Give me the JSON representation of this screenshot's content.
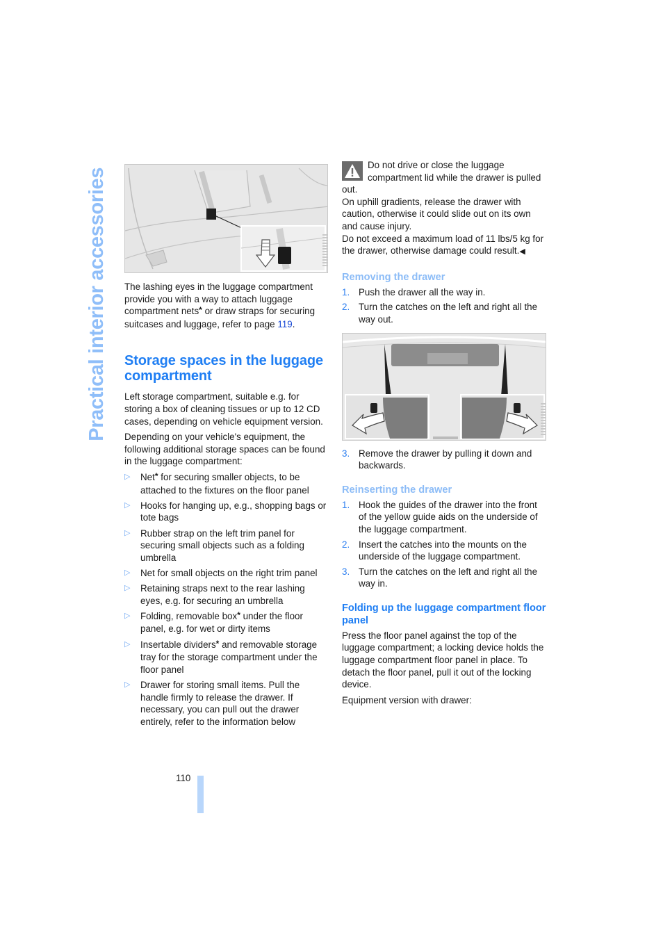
{
  "side_title": "Practical interior accessories",
  "left": {
    "figure1_alt": "Rear seat with lashing eye and belt strap, inset showing strap attachment with arrow",
    "intro": {
      "before_star": "The lashing eyes in the luggage compartment provide you with a way to attach luggage compartment nets",
      "star": "*",
      "after_star": " or draw straps for securing suitcases and luggage, refer to page ",
      "page_link": "119",
      "end": "."
    },
    "section_title": "Storage spaces in the luggage compartment",
    "para1": "Left storage compartment, suitable e.g. for storing a box of cleaning tissues or up to 12 CD cases, depending on vehicle equipment version.",
    "para2": "Depending on your vehicle's equipment, the following additional storage spaces can be found in the luggage compartment:",
    "bullet_glyph": "▷",
    "bullets": [
      {
        "pre": "Net",
        "star": "*",
        "post": " for securing smaller objects, to be attached to the fixtures on the floor panel"
      },
      {
        "pre": "Hooks for hanging up, e.g., shopping bags or tote bags",
        "star": "",
        "post": ""
      },
      {
        "pre": "Rubber strap on the left trim panel for securing small objects such as a folding umbrella",
        "star": "",
        "post": ""
      },
      {
        "pre": "Net for small objects on the right trim panel",
        "star": "",
        "post": ""
      },
      {
        "pre": "Retaining straps next to the rear lashing eyes, e.g. for securing an umbrella",
        "star": "",
        "post": ""
      },
      {
        "pre": "Folding, removable box",
        "star": "*",
        "post": " under the floor panel, e.g. for wet or dirty items"
      },
      {
        "pre": "Insertable dividers",
        "star": "*",
        "post": " and removable storage tray for the storage compartment under the floor panel"
      },
      {
        "pre": "Drawer for storing small items. Pull the handle firmly to release the drawer. If necessary, you can pull out the drawer entirely, refer to the information below",
        "star": "",
        "post": ""
      }
    ]
  },
  "right": {
    "warning": {
      "icon": "warning-triangle-icon",
      "lines": [
        "Do not drive or close the luggage compartment lid while the drawer is pulled out.",
        "On uphill gradients, release the drawer with caution, otherwise it could slide out on its own and cause injury.",
        "Do not exceed a maximum load of 11 lbs/5 kg for the drawer, otherwise damage could result."
      ],
      "end_mark": "◀"
    },
    "removing": {
      "title": "Removing the drawer",
      "steps_before_figure": [
        {
          "num": "1.",
          "text": "Push the drawer all the way in."
        },
        {
          "num": "2.",
          "text": "Turn the catches on the left and right all the way out."
        }
      ],
      "figure_alt": "Luggage compartment underside with two catches turned outward, arrows indicating direction",
      "steps_after_figure": [
        {
          "num": "3.",
          "text": "Remove the drawer by pulling it down and backwards."
        }
      ]
    },
    "reinserting": {
      "title": "Reinserting the drawer",
      "steps": [
        {
          "num": "1.",
          "text": "Hook the guides of the drawer into the front of the yellow guide aids on the underside of the luggage compartment."
        },
        {
          "num": "2.",
          "text": "Insert the catches into the mounts on the underside of the luggage compartment."
        },
        {
          "num": "3.",
          "text": "Turn the catches on the left and right all the way in."
        }
      ]
    },
    "folding": {
      "title": "Folding up the luggage compartment floor panel",
      "para": "Press the floor panel against the top of the luggage compartment; a locking device holds the luggage compartment floor panel in place. To detach the floor panel, pull it out of the locking device.",
      "para2": "Equipment version with drawer:"
    }
  },
  "footer": {
    "page_number": "110"
  }
}
